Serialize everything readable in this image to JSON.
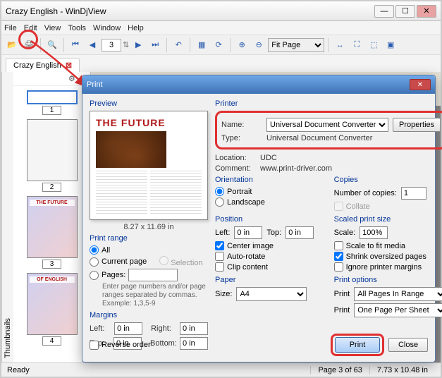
{
  "window": {
    "title": "Crazy English - WinDjView"
  },
  "menu": {
    "file": "File",
    "edit": "Edit",
    "view": "View",
    "tools": "Tools",
    "window": "Window",
    "help": "Help"
  },
  "toolbar": {
    "page_value": "3",
    "fit_value": "Fit Page"
  },
  "doc_tab": {
    "label": "Crazy English"
  },
  "thumbnails": {
    "title": "Thumbnails",
    "items": [
      {
        "num": "1",
        "overlay": ""
      },
      {
        "num": "2",
        "overlay": ""
      },
      {
        "num": "3",
        "overlay": "THE FUTURE"
      },
      {
        "num": "4",
        "overlay": "OF ENGLISH"
      }
    ]
  },
  "content": {
    "banner": "THE FUTURE"
  },
  "dialog": {
    "title": "Print",
    "preview": {
      "label": "Preview",
      "doc_title": "THE FUTURE",
      "dimensions": "8.27 x 11.69 in"
    },
    "printer": {
      "label": "Printer",
      "name_label": "Name:",
      "name_value": "Universal Document Converter",
      "properties": "Properties",
      "type_label": "Type:",
      "type_value": "Universal Document Converter",
      "location_label": "Location:",
      "location_value": "UDC",
      "comment_label": "Comment:",
      "comment_value": "www.print-driver.com"
    },
    "orientation": {
      "label": "Orientation",
      "portrait": "Portrait",
      "landscape": "Landscape"
    },
    "copies": {
      "label": "Copies",
      "num_label": "Number of copies:",
      "num_value": "1",
      "collate": "Collate"
    },
    "print_range": {
      "label": "Print range",
      "all": "All",
      "current": "Current page",
      "selection": "Selection",
      "pages": "Pages:",
      "hint": "Enter page numbers and/or page ranges separated by commas. Example: 1,3,5-9"
    },
    "position": {
      "label": "Position",
      "left_label": "Left:",
      "left_value": "0 in",
      "top_label": "Top:",
      "top_value": "0 in",
      "center": "Center image",
      "auto_rotate": "Auto-rotate",
      "clip": "Clip content"
    },
    "scaled": {
      "label": "Scaled print size",
      "scale_label": "Scale:",
      "scale_value": "100%",
      "fit_media": "Scale to fit media",
      "shrink": "Shrink oversized pages",
      "ignore": "Ignore printer margins"
    },
    "margins": {
      "label": "Margins",
      "left_label": "Left:",
      "left_value": "0 in",
      "right_label": "Right:",
      "right_value": "0 in",
      "top_label": "Top:",
      "top_value": "0 in",
      "bottom_label": "Bottom:",
      "bottom_value": "0 in"
    },
    "paper": {
      "label": "Paper",
      "size_label": "Size:",
      "size_value": "A4"
    },
    "print_opts": {
      "label": "Print options",
      "p1_label": "Print",
      "p1_value": "All Pages In Range",
      "p2_label": "Print",
      "p2_value": "One Page Per Sheet"
    },
    "reverse": "Reverse order",
    "buttons": {
      "print": "Print",
      "close": "Close"
    }
  },
  "status": {
    "ready": "Ready",
    "page": "Page 3 of 63",
    "dim": "7.73 x 10.48 in"
  }
}
